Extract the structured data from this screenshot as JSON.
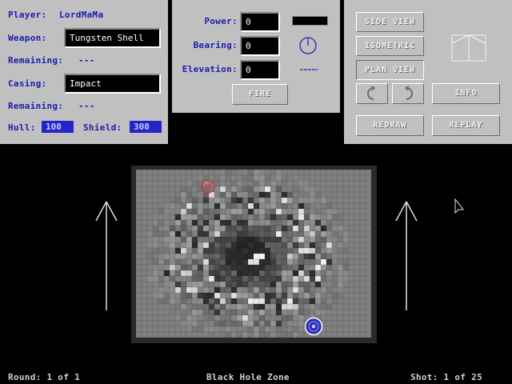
{
  "player_panel": {
    "player_label": "Player:",
    "player_name": "LordMaMa",
    "weapon_label": "Weapon:",
    "weapon_value": "Tungsten Shell",
    "weapon_remaining_label": "Remaining:",
    "weapon_remaining_value": "---",
    "casing_label": "Casing:",
    "casing_value": "Impact",
    "casing_remaining_label": "Remaining:",
    "casing_remaining_value": "---",
    "hull_label": "Hull:",
    "hull_value": "100",
    "shield_label": "Shield:",
    "shield_value": "300"
  },
  "fire_panel": {
    "power_label": "Power:",
    "power_value": "0",
    "bearing_label": "Bearing:",
    "bearing_value": "0",
    "elevation_label": "Elevation:",
    "elevation_value": "0",
    "fire_label": "FIRE"
  },
  "view_panel": {
    "side_view_label": "SIDE VIEW",
    "isometric_label": "ISOMETRIC",
    "plan_view_label": "PLAN VIEW",
    "info_label": "INFO",
    "redraw_label": "REDRAW",
    "replay_label": "REPLAY"
  },
  "status_bar": {
    "round": "Round: 1 of 1",
    "zone": "Black Hole Zone",
    "shot": "Shot: 1 of 25"
  },
  "colors": {
    "panel": "#c0c0c0",
    "label_blue": "#1a1ab0",
    "stat_field": "#2424c8",
    "enemy_tank": "#e03030",
    "player_tank": "#3030b0"
  }
}
